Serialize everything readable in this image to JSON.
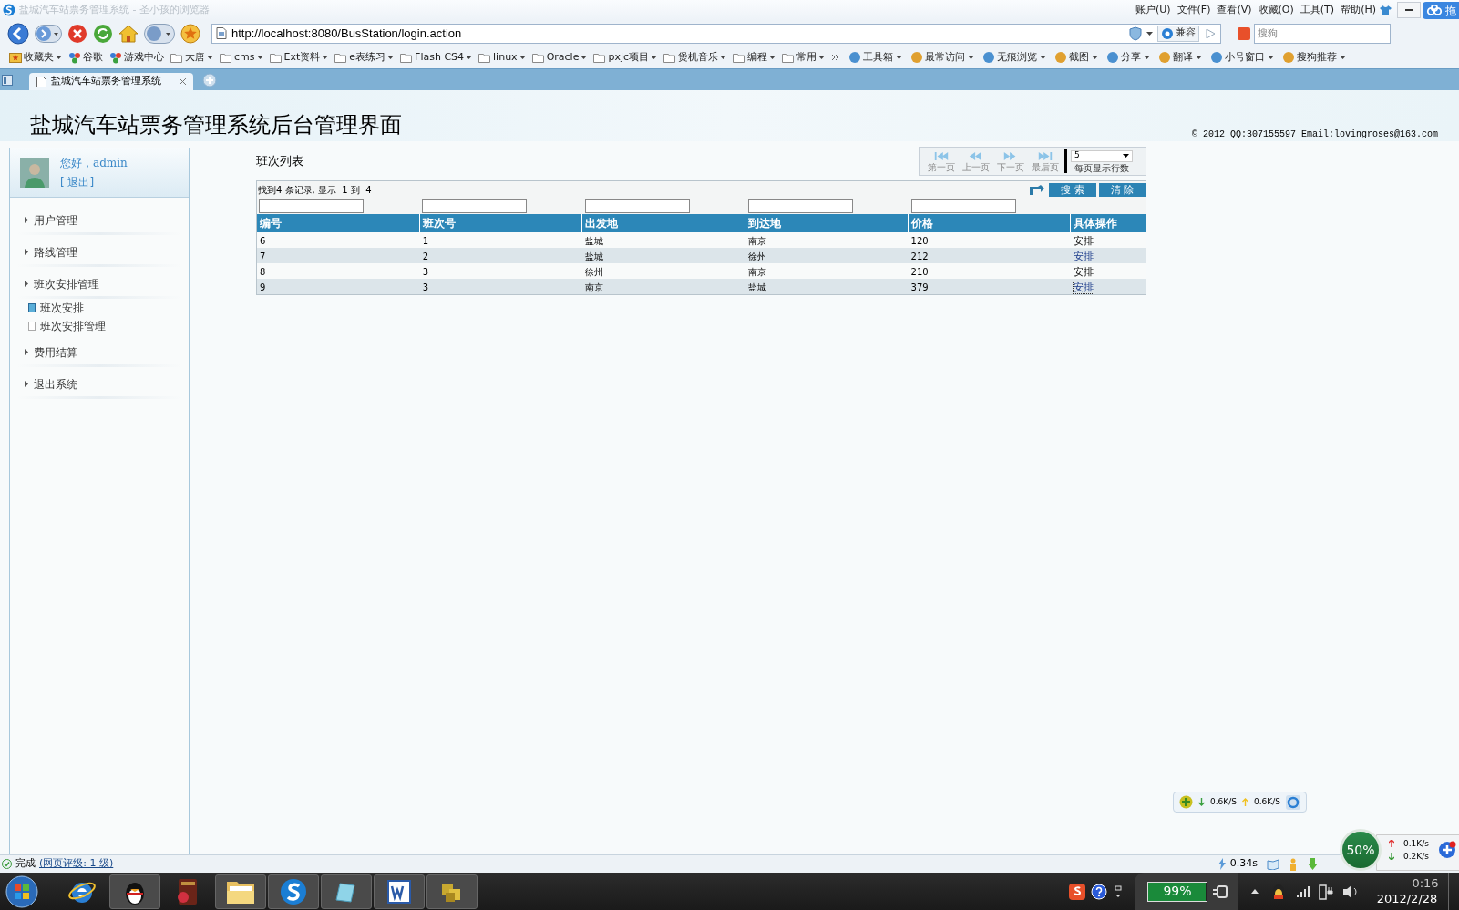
{
  "window": {
    "title": "盐城汽车站票务管理系统 - 圣小孩的浏览器",
    "menu": [
      "账户(U)",
      "文件(F)",
      "查看(V)",
      "收藏(O)",
      "工具(T)",
      "帮助(H)"
    ],
    "side_widget": "拖"
  },
  "toolbar": {
    "address": "http://localhost:8080/BusStation/login.action",
    "compat": "兼容",
    "search_placeholder": "搜狗"
  },
  "bookmarks": [
    {
      "label": "收藏夹",
      "kind": "star"
    },
    {
      "label": "谷歌",
      "kind": "link"
    },
    {
      "label": "游戏中心",
      "kind": "link"
    },
    {
      "label": "大唐",
      "kind": "folder"
    },
    {
      "label": "cms",
      "kind": "folder"
    },
    {
      "label": "Ext资料",
      "kind": "folder"
    },
    {
      "label": "e表练习",
      "kind": "folder"
    },
    {
      "label": "Flash CS4",
      "kind": "folder"
    },
    {
      "label": "linux",
      "kind": "folder"
    },
    {
      "label": "Oracle",
      "kind": "folder"
    },
    {
      "label": "pxjc项目",
      "kind": "folder"
    },
    {
      "label": "煲机音乐",
      "kind": "folder"
    },
    {
      "label": "编程",
      "kind": "folder"
    },
    {
      "label": "常用",
      "kind": "folder"
    }
  ],
  "tools": [
    "工具箱",
    "最常访问",
    "无痕浏览",
    "截图",
    "分享",
    "翻译",
    "小号窗口",
    "搜狗推荐"
  ],
  "tabs": [
    {
      "label": "盐城汽车站票务管理系统",
      "selected": true
    }
  ],
  "page": {
    "title": "盐城汽车站票务管理系统后台管理界面",
    "copyright": "© 2012 QQ:307155597 Email:lovingroses@163.com",
    "user": {
      "greeting": "您好，admin",
      "logout": "[ 退出]"
    },
    "nav": [
      {
        "label": "用户管理",
        "kind": "section",
        "selected": false
      },
      {
        "label": "路线管理",
        "kind": "section",
        "selected": false
      },
      {
        "label": "班次安排管理",
        "kind": "section",
        "selected": false
      },
      {
        "label": "班次安排",
        "kind": "item",
        "selected": true
      },
      {
        "label": "班次安排管理",
        "kind": "item",
        "selected": false
      },
      {
        "label": "费用结算",
        "kind": "section",
        "selected": false
      },
      {
        "label": "退出系统",
        "kind": "section",
        "selected": false
      }
    ],
    "list_title": "班次列表",
    "pager": {
      "buttons": [
        "第一页",
        "上一页",
        "下一页",
        "最后页"
      ],
      "page_size": "5",
      "page_size_label": "每页显示行数"
    },
    "records_info": "找到4 条记录, 显示  1 到  4",
    "search_button": "搜 索",
    "clear_button": "清 除",
    "table": {
      "columns": [
        "编号",
        "班次号",
        "出发地",
        "到达地",
        "价格",
        "具体操作"
      ],
      "rows": [
        {
          "cells": [
            "6",
            "1",
            "盐城",
            "南京",
            "120"
          ],
          "action": "安排",
          "visited": false,
          "focused": false
        },
        {
          "cells": [
            "7",
            "2",
            "盐城",
            "徐州",
            "212"
          ],
          "action": "安排",
          "visited": true,
          "focused": false
        },
        {
          "cells": [
            "8",
            "3",
            "徐州",
            "南京",
            "210"
          ],
          "action": "安排",
          "visited": false,
          "focused": false
        },
        {
          "cells": [
            "9",
            "3",
            "南京",
            "盐城",
            "379"
          ],
          "action": "安排",
          "visited": true,
          "focused": true
        }
      ]
    }
  },
  "status_bar": {
    "status": "完成",
    "rating": "(网页评级: 1 级)",
    "load_time": "0.34s"
  },
  "net_widget": {
    "down": "0.6K/S",
    "up": "0.6K/S"
  },
  "speed_widget": {
    "percent": "50%",
    "up": "0.1K/s",
    "down": "0.2K/s"
  },
  "taskbar": {
    "apps": [
      {
        "kind": "ie"
      },
      {
        "kind": "qq"
      },
      {
        "kind": "diary"
      },
      {
        "kind": "folder"
      },
      {
        "kind": "sogou"
      },
      {
        "kind": "notepad"
      },
      {
        "kind": "word"
      },
      {
        "kind": "coins"
      }
    ],
    "battery": "99%",
    "battery_level": {
      "level": 0.99
    },
    "time": "0:16",
    "date": "2012/2/28"
  }
}
